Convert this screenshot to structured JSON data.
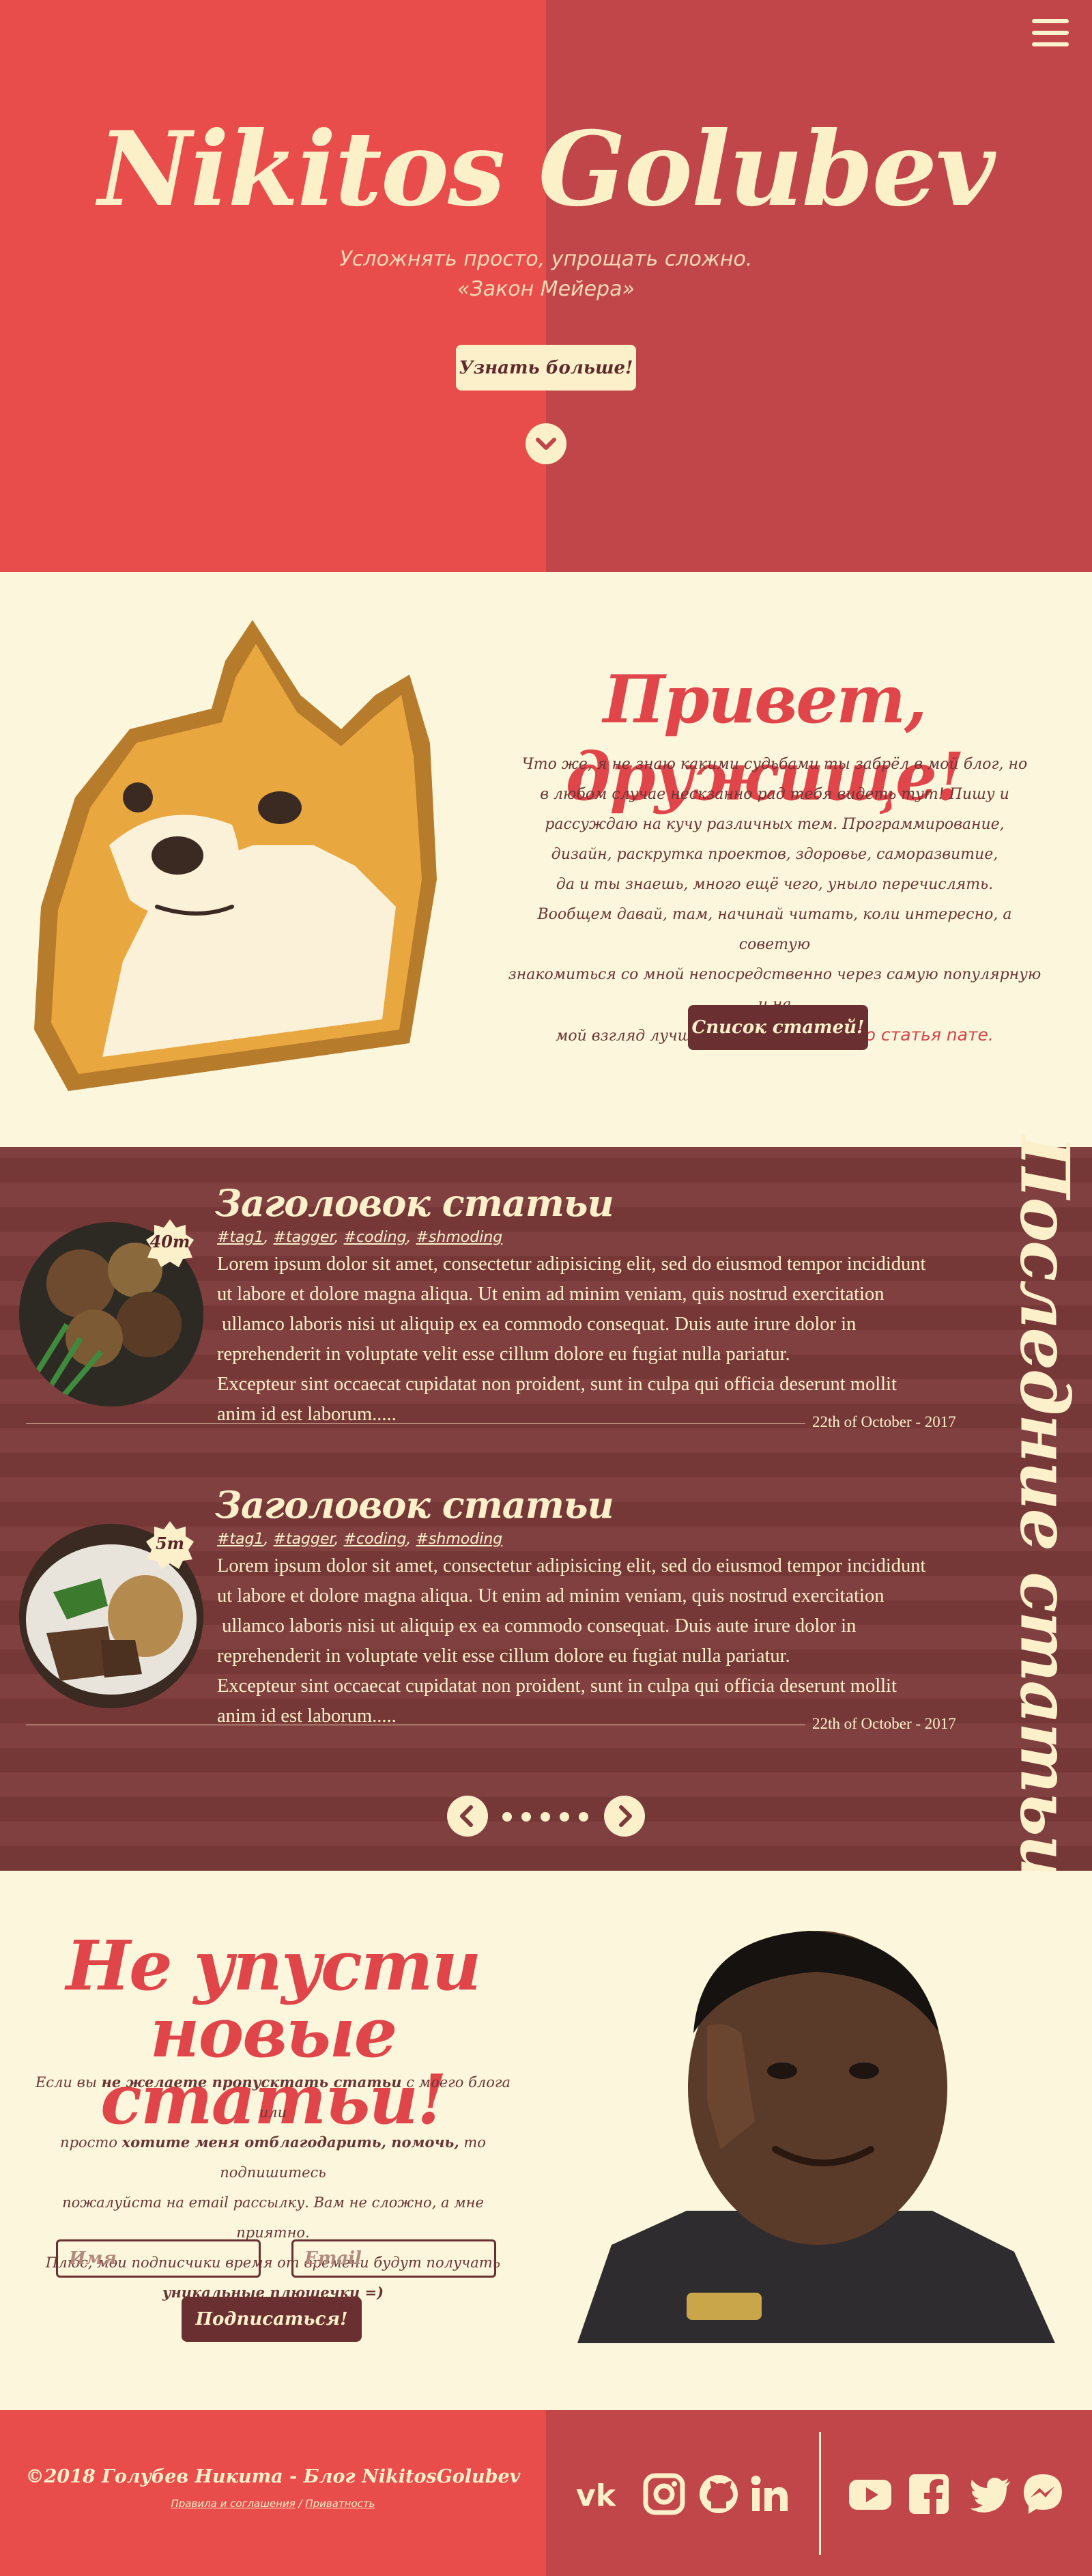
{
  "hero": {
    "title": "Nikitos Golubev",
    "quote_line1": "Усложнять просто, упрощать сложно.",
    "quote_line2": "«Закон Мейера»",
    "more_button": "Узнать больше!"
  },
  "intro": {
    "title": "Привет, дружище!",
    "text_lines": [
      "Что же, я не знаю какими судьбами ты забрёл в мой блог, но",
      "в любом случае нескзанно рад тебя видеть тут! Пишу и",
      "рассуждаю на кучу различных тем. Программирование,",
      "дизайн, раскрутка проектов, здоровье, саморазвитие,",
      "да и ты знаешь, много ещё чего, уныло перечислять.",
      "Вообщем давай, там, начинай читать, коли интересно, а советую",
      "знакомиться со мной непосредственно через самую популярную и на"
    ],
    "text_last": "мой взгляд лучшую статью:",
    "link_text": "Какая-то статья nате.",
    "list_button": "Список статей!"
  },
  "articles": {
    "side_title": "Последние статьи",
    "items": [
      {
        "title": "Заголовок статьи",
        "read_time": "40m",
        "tags": [
          "#tag1",
          "#tagger",
          "#coding",
          "#shmoding"
        ],
        "body_lines": [
          "Lorem ipsum dolor sit amet, consectetur adipisicing elit, sed do eiusmod tempor incididunt",
          "ut labore et dolore magna aliqua. Ut enim ad minim veniam, quis nostrud exercitation",
          " ullamco laboris nisi ut aliquip ex ea commodo consequat. Duis aute irure dolor in",
          "reprehenderit in voluptate velit esse cillum dolore eu fugiat nulla pariatur.",
          "Excepteur sint occaecat cupidatat non proident, sunt in culpa qui officia deserunt mollit",
          "anim id est laborum....."
        ],
        "date": "22th of October - 2017"
      },
      {
        "title": "Заголовок статьи",
        "read_time": "5m",
        "tags": [
          "#tag1",
          "#tagger",
          "#coding",
          "#shmoding"
        ],
        "body_lines": [
          "Lorem ipsum dolor sit amet, consectetur adipisicing elit, sed do eiusmod tempor incididunt",
          "ut labore et dolore magna aliqua. Ut enim ad minim veniam, quis nostrud exercitation",
          " ullamco laboris nisi ut aliquip ex ea commodo consequat. Duis aute irure dolor in",
          "reprehenderit in voluptate velit esse cillum dolore eu fugiat nulla pariatur.",
          "Excepteur sint occaecat cupidatat non proident, sunt in culpa qui officia deserunt mollit",
          "anim id est laborum....."
        ],
        "date": "22th of October - 2017"
      }
    ],
    "pager_dots": 5
  },
  "subscribe": {
    "title_line1": "Не упусти",
    "title_line2": "новые статьи!",
    "line1_a": "Если вы ",
    "line1_b": "не желаете пропусктать статьи",
    "line1_c": " с моего блога или",
    "line2_a": "просто ",
    "line2_b": "хотите меня отблагодарить, помочь,",
    "line2_c": " то подпишитесь",
    "line3": "пожалуйста на email рассылку. Вам не сложно, а мне приятно.",
    "line4": "Плюс, мои подписчики время от времени будут получать",
    "line5": "уникальные плюшечки =)",
    "name_placeholder": "Имя",
    "email_placeholder": "Email",
    "button": "Подписаться!"
  },
  "footer": {
    "copyright": "©2018 Голубев Никита - Блог NikitosGolubev",
    "rules_link": "Правила и соглашения",
    "separator": " / ",
    "privacy_link": "Приватность",
    "social_icons": [
      "vk-icon",
      "instagram-icon",
      "github-icon",
      "linkedin-icon",
      "youtube-icon",
      "facebook-icon",
      "twitter-icon",
      "messenger-icon"
    ]
  },
  "colors": {
    "red": "#e84c4b",
    "dark_red": "#c1464a",
    "cream": "#fbf0ca",
    "maroon": "#6a2f30",
    "brick": "#7c3a3a"
  }
}
